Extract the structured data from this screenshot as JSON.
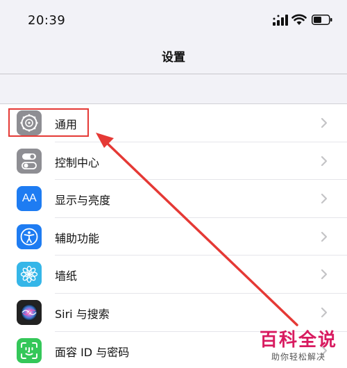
{
  "status_bar": {
    "time": "20:39",
    "icons": [
      "signal-icon",
      "wifi-icon",
      "battery-icon"
    ]
  },
  "nav": {
    "title": "设置"
  },
  "settings": {
    "items": [
      {
        "label": "通用",
        "icon": "gear-icon",
        "color": "#8e8e93"
      },
      {
        "label": "控制中心",
        "icon": "toggle-icon",
        "color": "#8e8e93"
      },
      {
        "label": "显示与亮度",
        "icon": "text-size-icon",
        "color": "#1e7cf2",
        "icon_text": "AA"
      },
      {
        "label": "辅助功能",
        "icon": "accessibility-icon",
        "color": "#1e7cf2"
      },
      {
        "label": "墙纸",
        "icon": "flower-icon",
        "color": "#35b6e8"
      },
      {
        "label": "Siri 与搜索",
        "icon": "siri-icon",
        "color": "#222222"
      },
      {
        "label": "面容 ID 与密码",
        "icon": "face-id-icon",
        "color": "#34c759"
      }
    ]
  },
  "annotation": {
    "highlight_color": "#e53935"
  },
  "watermark": {
    "title": "百科全说",
    "subtitle": "助你轻松解决"
  }
}
